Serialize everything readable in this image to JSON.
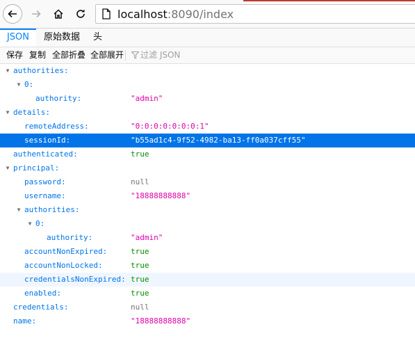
{
  "browser": {
    "url_host": "localhost",
    "url_path": ":8090/index",
    "icons": [
      "back-icon",
      "forward-icon",
      "home-icon",
      "reload-icon",
      "page-icon"
    ]
  },
  "tabs": [
    {
      "label": "JSON",
      "active": true
    },
    {
      "label": "原始数据",
      "active": false
    },
    {
      "label": "头",
      "active": false
    }
  ],
  "actions": {
    "save": "保存",
    "copy": "复制",
    "collapse_all": "全部折叠",
    "expand_all": "全部展开",
    "filter_placeholder": "过滤 JSON"
  },
  "tree": [
    {
      "depth": 0,
      "twisty": true,
      "key": "authorities:",
      "value": "",
      "type": ""
    },
    {
      "depth": 1,
      "twisty": true,
      "key": "0:",
      "value": "",
      "type": ""
    },
    {
      "depth": 2,
      "twisty": false,
      "key": "authority:",
      "value": "\"admin\"",
      "type": "str"
    },
    {
      "depth": 0,
      "twisty": true,
      "key": "details:",
      "value": "",
      "type": ""
    },
    {
      "depth": 1,
      "twisty": false,
      "key": "remoteAddress:",
      "value": "\"0:0:0:0:0:0:0:1\"",
      "type": "str"
    },
    {
      "depth": 1,
      "twisty": false,
      "key": "sessionId:",
      "value": "\"b55ad1c4-9f52-4982-ba13-ff0a037cff55\"",
      "type": "str",
      "selected": true
    },
    {
      "depth": 0,
      "twisty": false,
      "key": "authenticated:",
      "value": "true",
      "type": "bool"
    },
    {
      "depth": 0,
      "twisty": true,
      "key": "principal:",
      "value": "",
      "type": ""
    },
    {
      "depth": 1,
      "twisty": false,
      "key": "password:",
      "value": "null",
      "type": "nul"
    },
    {
      "depth": 1,
      "twisty": false,
      "key": "username:",
      "value": "\"18888888888\"",
      "type": "str"
    },
    {
      "depth": 1,
      "twisty": true,
      "key": "authorities:",
      "value": "",
      "type": ""
    },
    {
      "depth": 2,
      "twisty": true,
      "key": "0:",
      "value": "",
      "type": ""
    },
    {
      "depth": 3,
      "twisty": false,
      "key": "authority:",
      "value": "\"admin\"",
      "type": "str"
    },
    {
      "depth": 1,
      "twisty": false,
      "key": "accountNonExpired:",
      "value": "true",
      "type": "bool"
    },
    {
      "depth": 1,
      "twisty": false,
      "key": "accountNonLocked:",
      "value": "true",
      "type": "bool"
    },
    {
      "depth": 1,
      "twisty": false,
      "key": "credentialsNonExpired:",
      "value": "true",
      "type": "bool",
      "hover": true
    },
    {
      "depth": 1,
      "twisty": false,
      "key": "enabled:",
      "value": "true",
      "type": "bool"
    },
    {
      "depth": 0,
      "twisty": false,
      "key": "credentials:",
      "value": "null",
      "type": "nul"
    },
    {
      "depth": 0,
      "twisty": false,
      "key": "name:",
      "value": "\"18888888888\"",
      "type": "str"
    }
  ]
}
